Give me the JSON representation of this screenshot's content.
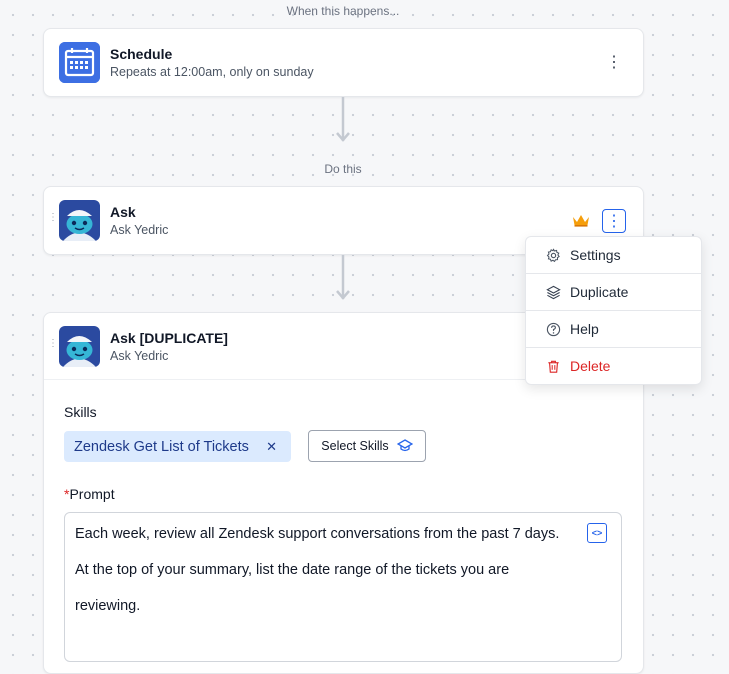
{
  "trigger_label": "When this happens...",
  "action_label": "Do this",
  "schedule_card": {
    "title": "Schedule",
    "subtitle": "Repeats at 12:00am, only on sunday",
    "menu_glyph": "⋮"
  },
  "ask_card": {
    "title": "Ask",
    "subtitle": "Ask Yedric",
    "menu_glyph": "⋮",
    "badge_icon": "crown-icon"
  },
  "context_menu": {
    "items": [
      {
        "label": "Settings",
        "icon": "gear-icon"
      },
      {
        "label": "Duplicate",
        "icon": "layers-icon"
      },
      {
        "label": "Help",
        "icon": "help-circle-icon"
      },
      {
        "label": "Delete",
        "icon": "trash-icon"
      }
    ]
  },
  "duplicate_card": {
    "title": "Ask [DUPLICATE]",
    "subtitle": "Ask Yedric",
    "skills_label": "Skills",
    "skill_chip": "Zendesk Get List of Tickets",
    "select_skills_label": "Select Skills",
    "prompt_required_mark": "*",
    "prompt_label": "Prompt",
    "prompt_lines": [
      "Each week, review all Zendesk support conversations from the past 7 days.",
      "At the top of your summary, list the date range of the tickets you are",
      "reviewing."
    ]
  },
  "colors": {
    "accent": "#2563eb",
    "danger": "#dc2626",
    "chip_bg": "#dbeafe",
    "crown": "#f59e0b"
  }
}
